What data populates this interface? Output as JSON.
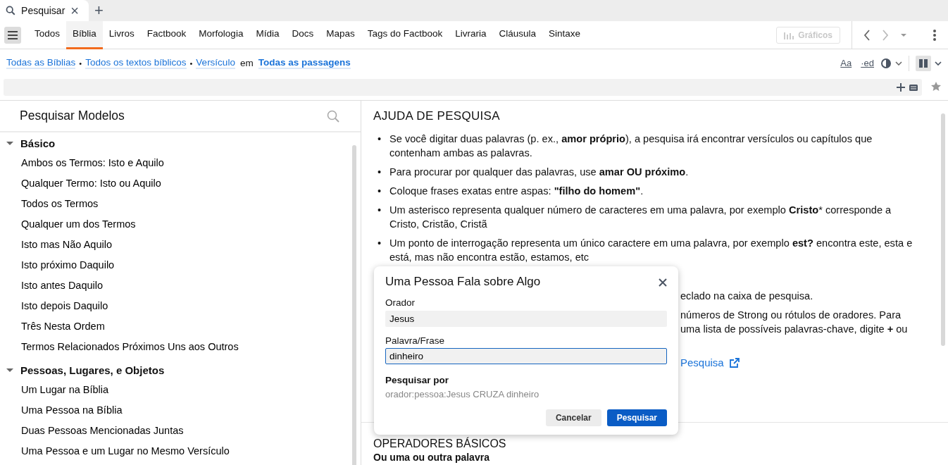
{
  "tab": {
    "label": "Pesquisar",
    "close": "×",
    "add": "+"
  },
  "nav_tabs": [
    {
      "label": "Todos",
      "selected": false
    },
    {
      "label": "Bíblia",
      "selected": true
    },
    {
      "label": "Livros",
      "selected": false
    },
    {
      "label": "Factbook",
      "selected": false
    },
    {
      "label": "Morfologia",
      "selected": false
    },
    {
      "label": "Mídia",
      "selected": false
    },
    {
      "label": "Docs",
      "selected": false
    },
    {
      "label": "Mapas",
      "selected": false
    },
    {
      "label": "Tags do Factbook",
      "selected": false
    },
    {
      "label": "Livraria",
      "selected": false
    },
    {
      "label": "Cláusula",
      "selected": false
    },
    {
      "label": "Sintaxe",
      "selected": false
    }
  ],
  "graphs_button": {
    "label": "Gráficos",
    "disabled": true
  },
  "breadcrumb": [
    {
      "kind": "link",
      "text": "Todas as Bíblias"
    },
    {
      "kind": "sep",
      "text": "•"
    },
    {
      "kind": "link",
      "text": "Todos os textos bíblicos"
    },
    {
      "kind": "sep",
      "text": "•"
    },
    {
      "kind": "link",
      "text": "Versículo"
    },
    {
      "kind": "text",
      "text": "em"
    },
    {
      "kind": "strong-link",
      "text": "Todas as passagens"
    }
  ],
  "format_buttons": [
    "Aa",
    "·ed"
  ],
  "templates": {
    "title": "Pesquisar Modelos",
    "groups": [
      {
        "label": "Básico",
        "expanded": true,
        "children": [
          {
            "label": "Ambos os Termos: Isto e Aquilo"
          },
          {
            "label": "Qualquer Termo: Isto ou Aquilo"
          },
          {
            "label": "Todos os Termos"
          },
          {
            "label": "Qualquer um dos Termos"
          },
          {
            "label": "Isto mas Não Aquilo"
          },
          {
            "label": "Isto próximo Daquilo"
          },
          {
            "label": "Isto antes Daquilo"
          },
          {
            "label": "Isto depois Daquilo"
          },
          {
            "label": "Três Nesta Ordem"
          },
          {
            "label": "Termos Relacionados Próximos Uns aos Outros"
          }
        ]
      },
      {
        "label": "Pessoas, Lugares, e Objetos",
        "expanded": true,
        "children": [
          {
            "label": "Um Lugar na Bíblia"
          },
          {
            "label": "Uma Pessoa na Bíblia"
          },
          {
            "label": "Duas Pessoas Mencionadas Juntas"
          },
          {
            "label": "Uma Pessoa e um Lugar no Mesmo Versículo"
          }
        ]
      }
    ]
  },
  "help": {
    "title": "AJUDA DE PESQUISA",
    "marker": "•",
    "bullets": [
      "Se você digitar duas palavras (p. ex., **amor próprio**), a pesquisa irá encontrar versículos ou capítulos que contenham ambas as palavras.",
      "Para procurar por qualquer das palavras, use **amar OU próximo**.",
      "Coloque frases exatas entre aspas: **\"filho do homem\"**.",
      "Um asterisco representa qualquer número de caracteres em uma palavra, por exemplo **Cristo*** corresponde a Cristo, Cristão, Cristã",
      "Um ponto de interrogação representa um único caractere em uma palavra, por exemplo **est?** encontra este, esta e está, mas não encontra estão, estamos, etc"
    ],
    "partial_lines": [
      "eclado na caixa de pesquisa.",
      "números de Strong ou rótulos de oradores. Para",
      "uma lista de possíveis palavras-chave, digite **+** ou"
    ],
    "link": "Pesquisa",
    "section_title": "OPERADORES BÁSICOS",
    "subheading": "Ou uma ou outra palavra"
  },
  "dialog": {
    "title": "Uma Pessoa Fala sobre Algo",
    "fields": [
      {
        "label": "Orador",
        "value": "Jesus",
        "focused": false
      },
      {
        "label": "Palavra/Frase",
        "value": "dinheiro",
        "focused": true
      }
    ],
    "query_label": "Pesquisar por",
    "query": "orador:pessoa:Jesus CRUZA dinheiro",
    "buttons": [
      {
        "label": "Cancelar",
        "kind": "secondary"
      },
      {
        "label": "Pesquisar",
        "kind": "primary"
      }
    ]
  }
}
